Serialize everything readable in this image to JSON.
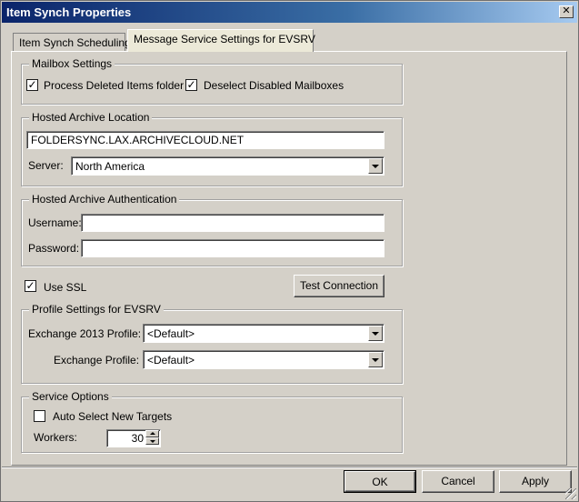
{
  "window": {
    "title": "Item Synch Properties",
    "close_glyph": "✕"
  },
  "tabs": [
    {
      "label": "Item Synch Scheduling"
    },
    {
      "label": "Message Service Settings for EVSRV"
    }
  ],
  "mailbox_settings": {
    "legend": "Mailbox Settings",
    "process_deleted": {
      "label": "Process Deleted Items folder",
      "checked": "✓"
    },
    "deselect_disabled": {
      "label": "Deselect Disabled Mailboxes",
      "checked": "✓"
    }
  },
  "hosted_archive_location": {
    "legend": "Hosted Archive Location",
    "url_value": "FOLDERSYNC.LAX.ARCHIVECLOUD.NET",
    "server_label": "Server:",
    "server_value": "North America"
  },
  "hosted_archive_auth": {
    "legend": "Hosted Archive Authentication",
    "username_label": "Username:",
    "username_value": "",
    "password_label": "Password:",
    "password_value": ""
  },
  "use_ssl": {
    "label": "Use SSL",
    "checked": "✓"
  },
  "test_connection_label": "Test Connection",
  "profile_settings": {
    "legend": "Profile Settings for EVSRV",
    "exchange2013_label": "Exchange 2013 Profile:",
    "exchange2013_value": "<Default>",
    "exchange_label": "Exchange Profile:",
    "exchange_value": "<Default>"
  },
  "service_options": {
    "legend": "Service Options",
    "auto_select": {
      "label": "Auto Select New Targets",
      "checked": ""
    },
    "workers_label": "Workers:",
    "workers_value": "30"
  },
  "footer": {
    "ok_label": "OK",
    "cancel_label": "Cancel",
    "apply_label": "Apply"
  }
}
